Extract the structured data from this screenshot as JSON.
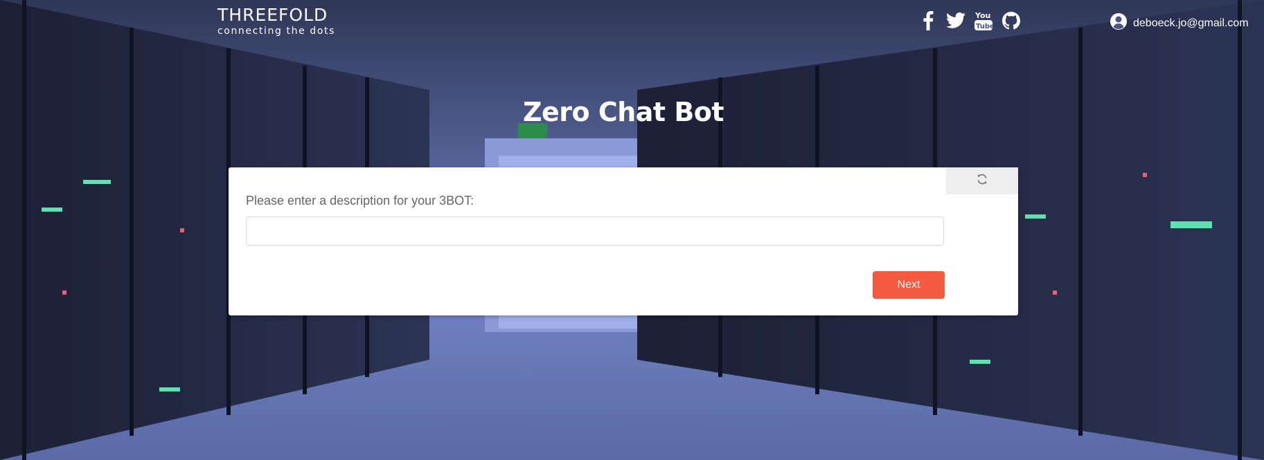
{
  "header": {
    "logo_main": "THREEFOLD",
    "logo_sub": "connecting the dots",
    "social_icons": [
      "facebook-icon",
      "twitter-icon",
      "youtube-icon",
      "github-icon"
    ],
    "user_email": "deboeck.jo@gmail.com",
    "user_icon": "user-circle-icon"
  },
  "main": {
    "title": "Zero Chat Bot",
    "question": "Please enter a description for your 3BOT:",
    "answer_value": "",
    "refresh_icon": "refresh-icon",
    "next_label": "Next"
  },
  "colors": {
    "accent": "#f35a3f",
    "card_bg": "#ffffff",
    "tab_bg": "#eeeeee"
  }
}
